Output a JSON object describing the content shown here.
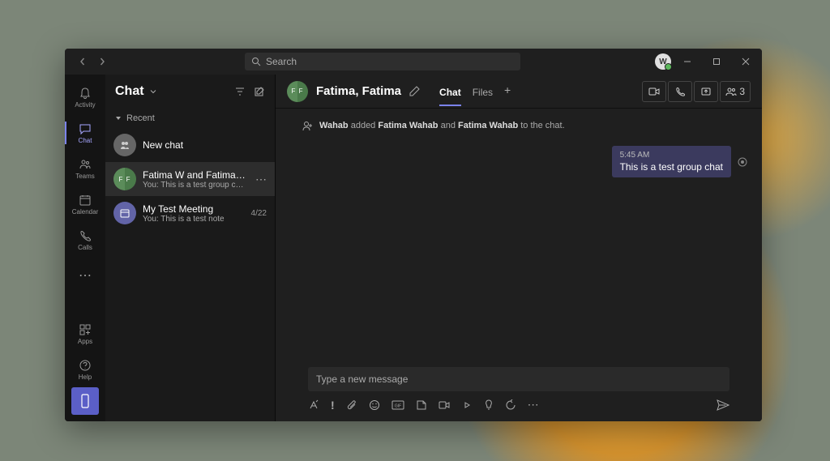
{
  "search": {
    "placeholder": "Search"
  },
  "user": {
    "initial": "W"
  },
  "rail": {
    "activity": "Activity",
    "chat": "Chat",
    "teams": "Teams",
    "calendar": "Calendar",
    "calls": "Calls",
    "apps": "Apps",
    "help": "Help"
  },
  "list": {
    "title": "Chat",
    "recent": "Recent",
    "items": [
      {
        "name": "New chat",
        "preview": "",
        "time": ""
      },
      {
        "name": "Fatima W and Fatima W",
        "preview": "You: This is a test group chat",
        "time": ""
      },
      {
        "name": "My Test Meeting",
        "preview": "You: This is a test note",
        "time": "4/22"
      }
    ]
  },
  "chat": {
    "title": "Fatima, Fatima",
    "tabs": {
      "chat": "Chat",
      "files": "Files"
    },
    "participants": "3",
    "system": {
      "actor": "Wahab",
      "verb": " added ",
      "p1": "Fatima Wahab",
      "conj": " and ",
      "p2": "Fatima Wahab",
      "suffix": " to the chat."
    },
    "message": {
      "time": "5:45 AM",
      "text": "This is a test group chat"
    },
    "compose": {
      "placeholder": "Type a new message"
    }
  }
}
